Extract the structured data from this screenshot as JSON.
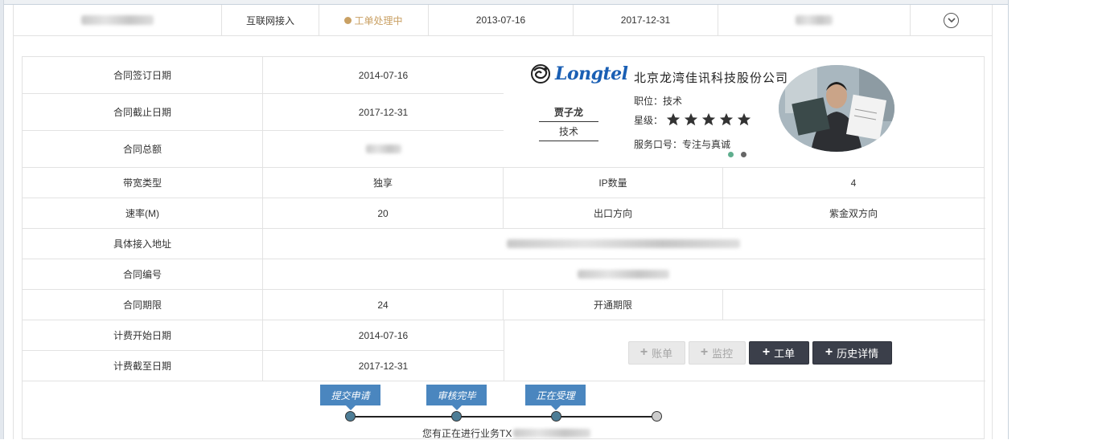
{
  "summary": {
    "col1_blurred": "",
    "access_type": "互联网接入",
    "status": "工单处理中",
    "start_date": "2013-07-16",
    "end_date": "2017-12-31",
    "col6_blurred": ""
  },
  "contract": {
    "sign_date_label": "合同签订日期",
    "sign_date": "2014-07-16",
    "expiry_label": "合同截止日期",
    "expiry_date": "2017-12-31",
    "amount_label": "合同总额",
    "bandwidth_type_label": "带宽类型",
    "bandwidth_type": "独享",
    "ip_count_label": "IP数量",
    "ip_count": "4",
    "rate_label": "速率(M)",
    "rate": "20",
    "egress_label": "出口方向",
    "egress": "紫金双方向",
    "address_label": "具体接入地址",
    "contract_no_label": "合同编号",
    "term_label": "合同期限",
    "term": "24",
    "activation_term_label": "开通期限",
    "activation_term": "",
    "billing_start_label": "计费开始日期",
    "billing_start": "2014-07-16",
    "billing_end_label": "计费截至日期",
    "billing_end": "2017-12-31"
  },
  "profile": {
    "logo_text": "Longtel",
    "company": "北京龙湾佳讯科技股份公司",
    "name": "贾子龙",
    "role": "技术",
    "position_line": "职位：技术",
    "star_label": "星级：",
    "star_rating": 5,
    "motto_line": "服务口号：专注与真诚"
  },
  "actions": {
    "bill": "账单",
    "monitor": "监控",
    "ticket": "工单",
    "history": "历史详情"
  },
  "timeline": {
    "steps": [
      "提交申请",
      "审核完毕",
      "正在受理"
    ],
    "message_prefix": "您有正在进行业务TX"
  },
  "colors": {
    "accent_dark": "#3b3f4a",
    "flag_blue": "#4a86bf",
    "status_gold": "#c9a063",
    "logo_blue": "#1a5fb4"
  }
}
